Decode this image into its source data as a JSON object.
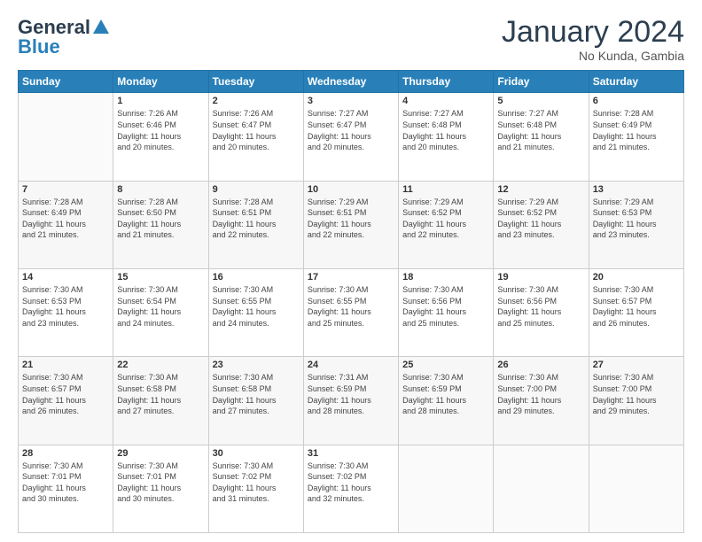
{
  "header": {
    "logo_general": "General",
    "logo_blue": "Blue",
    "month_title": "January 2024",
    "location": "No Kunda, Gambia"
  },
  "weekdays": [
    "Sunday",
    "Monday",
    "Tuesday",
    "Wednesday",
    "Thursday",
    "Friday",
    "Saturday"
  ],
  "weeks": [
    [
      {
        "day": "",
        "info": ""
      },
      {
        "day": "1",
        "info": "Sunrise: 7:26 AM\nSunset: 6:46 PM\nDaylight: 11 hours\nand 20 minutes."
      },
      {
        "day": "2",
        "info": "Sunrise: 7:26 AM\nSunset: 6:47 PM\nDaylight: 11 hours\nand 20 minutes."
      },
      {
        "day": "3",
        "info": "Sunrise: 7:27 AM\nSunset: 6:47 PM\nDaylight: 11 hours\nand 20 minutes."
      },
      {
        "day": "4",
        "info": "Sunrise: 7:27 AM\nSunset: 6:48 PM\nDaylight: 11 hours\nand 20 minutes."
      },
      {
        "day": "5",
        "info": "Sunrise: 7:27 AM\nSunset: 6:48 PM\nDaylight: 11 hours\nand 21 minutes."
      },
      {
        "day": "6",
        "info": "Sunrise: 7:28 AM\nSunset: 6:49 PM\nDaylight: 11 hours\nand 21 minutes."
      }
    ],
    [
      {
        "day": "7",
        "info": "Sunrise: 7:28 AM\nSunset: 6:49 PM\nDaylight: 11 hours\nand 21 minutes."
      },
      {
        "day": "8",
        "info": "Sunrise: 7:28 AM\nSunset: 6:50 PM\nDaylight: 11 hours\nand 21 minutes."
      },
      {
        "day": "9",
        "info": "Sunrise: 7:28 AM\nSunset: 6:51 PM\nDaylight: 11 hours\nand 22 minutes."
      },
      {
        "day": "10",
        "info": "Sunrise: 7:29 AM\nSunset: 6:51 PM\nDaylight: 11 hours\nand 22 minutes."
      },
      {
        "day": "11",
        "info": "Sunrise: 7:29 AM\nSunset: 6:52 PM\nDaylight: 11 hours\nand 22 minutes."
      },
      {
        "day": "12",
        "info": "Sunrise: 7:29 AM\nSunset: 6:52 PM\nDaylight: 11 hours\nand 23 minutes."
      },
      {
        "day": "13",
        "info": "Sunrise: 7:29 AM\nSunset: 6:53 PM\nDaylight: 11 hours\nand 23 minutes."
      }
    ],
    [
      {
        "day": "14",
        "info": "Sunrise: 7:30 AM\nSunset: 6:53 PM\nDaylight: 11 hours\nand 23 minutes."
      },
      {
        "day": "15",
        "info": "Sunrise: 7:30 AM\nSunset: 6:54 PM\nDaylight: 11 hours\nand 24 minutes."
      },
      {
        "day": "16",
        "info": "Sunrise: 7:30 AM\nSunset: 6:55 PM\nDaylight: 11 hours\nand 24 minutes."
      },
      {
        "day": "17",
        "info": "Sunrise: 7:30 AM\nSunset: 6:55 PM\nDaylight: 11 hours\nand 25 minutes."
      },
      {
        "day": "18",
        "info": "Sunrise: 7:30 AM\nSunset: 6:56 PM\nDaylight: 11 hours\nand 25 minutes."
      },
      {
        "day": "19",
        "info": "Sunrise: 7:30 AM\nSunset: 6:56 PM\nDaylight: 11 hours\nand 25 minutes."
      },
      {
        "day": "20",
        "info": "Sunrise: 7:30 AM\nSunset: 6:57 PM\nDaylight: 11 hours\nand 26 minutes."
      }
    ],
    [
      {
        "day": "21",
        "info": "Sunrise: 7:30 AM\nSunset: 6:57 PM\nDaylight: 11 hours\nand 26 minutes."
      },
      {
        "day": "22",
        "info": "Sunrise: 7:30 AM\nSunset: 6:58 PM\nDaylight: 11 hours\nand 27 minutes."
      },
      {
        "day": "23",
        "info": "Sunrise: 7:30 AM\nSunset: 6:58 PM\nDaylight: 11 hours\nand 27 minutes."
      },
      {
        "day": "24",
        "info": "Sunrise: 7:31 AM\nSunset: 6:59 PM\nDaylight: 11 hours\nand 28 minutes."
      },
      {
        "day": "25",
        "info": "Sunrise: 7:30 AM\nSunset: 6:59 PM\nDaylight: 11 hours\nand 28 minutes."
      },
      {
        "day": "26",
        "info": "Sunrise: 7:30 AM\nSunset: 7:00 PM\nDaylight: 11 hours\nand 29 minutes."
      },
      {
        "day": "27",
        "info": "Sunrise: 7:30 AM\nSunset: 7:00 PM\nDaylight: 11 hours\nand 29 minutes."
      }
    ],
    [
      {
        "day": "28",
        "info": "Sunrise: 7:30 AM\nSunset: 7:01 PM\nDaylight: 11 hours\nand 30 minutes."
      },
      {
        "day": "29",
        "info": "Sunrise: 7:30 AM\nSunset: 7:01 PM\nDaylight: 11 hours\nand 30 minutes."
      },
      {
        "day": "30",
        "info": "Sunrise: 7:30 AM\nSunset: 7:02 PM\nDaylight: 11 hours\nand 31 minutes."
      },
      {
        "day": "31",
        "info": "Sunrise: 7:30 AM\nSunset: 7:02 PM\nDaylight: 11 hours\nand 32 minutes."
      },
      {
        "day": "",
        "info": ""
      },
      {
        "day": "",
        "info": ""
      },
      {
        "day": "",
        "info": ""
      }
    ]
  ]
}
